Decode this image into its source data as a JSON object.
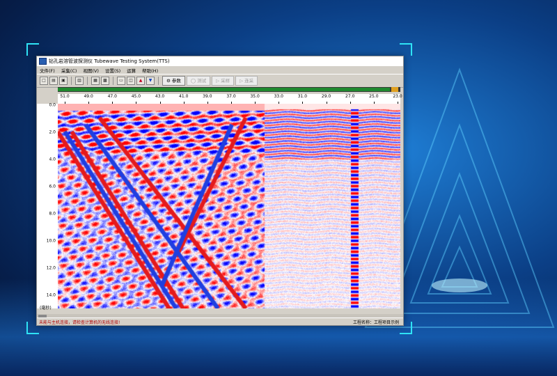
{
  "window": {
    "title": "钻孔岩溶管波探测仪   Tubewave Testing System(TTS)"
  },
  "menu": {
    "items": [
      "文件(F)",
      "采集(C)",
      "视图(V)",
      "设置(S)",
      "运算",
      "帮助(H)"
    ]
  },
  "toolbar": {
    "params_label": "参数",
    "test_label": "测试",
    "single_sample_label": "采样",
    "continuous_sample_label": "连采"
  },
  "x_axis": {
    "ticks": [
      "51.0",
      "49.0",
      "47.0",
      "45.0",
      "43.0",
      "41.0",
      "39.0",
      "37.0",
      "35.0",
      "33.0",
      "31.0",
      "29.0",
      "27.0",
      "25.0",
      "23.0"
    ]
  },
  "y_axis": {
    "ticks": [
      "0.0",
      "2.0",
      "4.0",
      "6.0",
      "8.0",
      "10.0",
      "12.0",
      "14.0"
    ],
    "unit": "(毫秒)"
  },
  "status": {
    "left": "未能与主机连接，请检查计算机的无线连接!",
    "right": "工程名称：工程项目示例"
  },
  "colors": {
    "positive": "#e41a1c",
    "negative": "#1f3fe0",
    "frame_accent": "#2fe3f5"
  },
  "progress": {
    "fraction": 0.97
  }
}
